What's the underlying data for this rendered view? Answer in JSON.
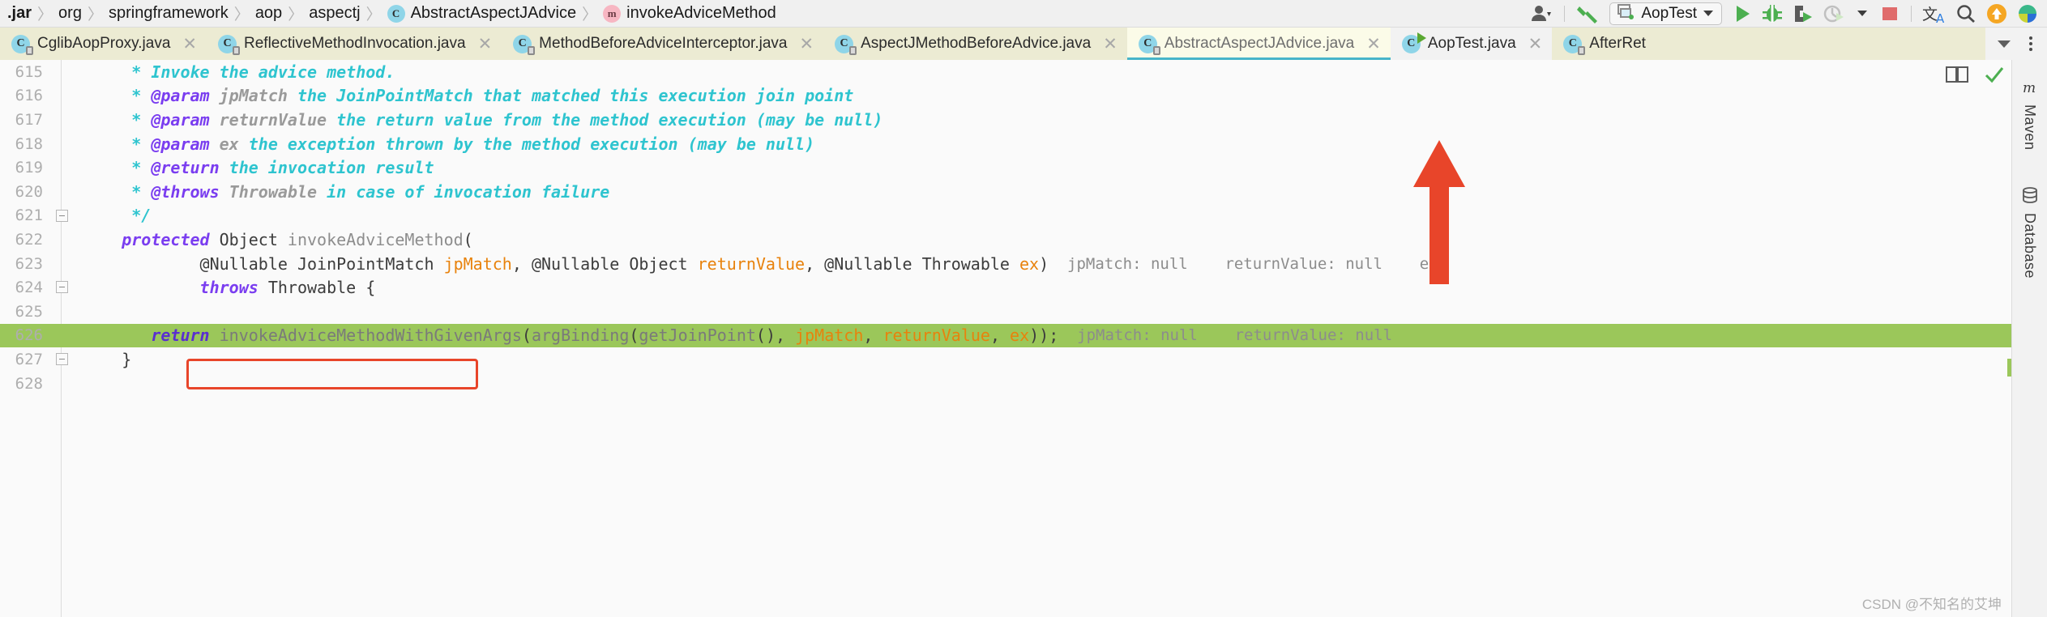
{
  "breadcrumb": {
    "items": [
      {
        "label": ".jar",
        "icon": null,
        "bold": true
      },
      {
        "label": "org",
        "icon": null,
        "bold": false
      },
      {
        "label": "springframework",
        "icon": null,
        "bold": false
      },
      {
        "label": "aop",
        "icon": null,
        "bold": false
      },
      {
        "label": "aspectj",
        "icon": null,
        "bold": false
      },
      {
        "label": "AbstractAspectJAdvice",
        "icon": "class-icon",
        "bold": false
      },
      {
        "label": "invokeAdviceMethod",
        "icon": "method-icon",
        "bold": false
      }
    ],
    "separator": "〉"
  },
  "toolbar": {
    "profile_icon": "user-icon",
    "build_icon": "hammer-icon",
    "run_config": {
      "label": "AopTest",
      "icon": "run-config-icon"
    },
    "run_icon": "run-icon",
    "debug_icon": "debug-icon",
    "coverage_icon": "run-with-coverage-icon",
    "profiler_icon": "profiler-icon",
    "stop_icon": "stop-icon",
    "translate_icon": "translate-icon",
    "search_icon": "search-icon",
    "update_icon": "update-icon",
    "ide_icon": "ide-logo-icon"
  },
  "tabs": [
    {
      "label": "CglibAopProxy.java",
      "icon": "java-class-icon",
      "state": "normal",
      "badge": "lock",
      "closable": true
    },
    {
      "label": "ReflectiveMethodInvocation.java",
      "icon": "java-class-icon",
      "state": "normal",
      "badge": "lock",
      "closable": true
    },
    {
      "label": "MethodBeforeAdviceInterceptor.java",
      "icon": "java-class-icon",
      "state": "normal",
      "badge": "lock",
      "closable": true
    },
    {
      "label": "AspectJMethodBeforeAdvice.java",
      "icon": "java-class-icon",
      "state": "normal",
      "badge": "lock",
      "closable": true
    },
    {
      "label": "AbstractAspectJAdvice.java",
      "icon": "java-class-icon",
      "state": "active",
      "badge": "lock",
      "closable": true
    },
    {
      "label": "AopTest.java",
      "icon": "java-class-icon",
      "state": "plain",
      "badge": "run",
      "closable": true
    },
    {
      "label": "AfterRet",
      "icon": "java-class-icon",
      "state": "normal",
      "badge": "lock",
      "closable": false
    }
  ],
  "tab_overflow": {
    "chevron": "chevron-down-icon",
    "kebab": "more-options-icon"
  },
  "editor": {
    "first_line_number": 615,
    "highlighted_line_number": 626,
    "lines": [
      {
        "n": 615,
        "fold": null,
        "tokens": [
          {
            "t": "      * ",
            "c": "c-doc"
          },
          {
            "t": "Invoke the advice method.",
            "c": "c-doc"
          }
        ]
      },
      {
        "n": 616,
        "fold": null,
        "tokens": [
          {
            "t": "      * ",
            "c": "c-doc"
          },
          {
            "t": "@param",
            "c": "c-tag"
          },
          {
            "t": " ",
            "c": "c-doc"
          },
          {
            "t": "jpMatch",
            "c": "c-docid"
          },
          {
            "t": " the JoinPointMatch that matched this execution join point",
            "c": "c-doc"
          }
        ]
      },
      {
        "n": 617,
        "fold": null,
        "tokens": [
          {
            "t": "      * ",
            "c": "c-doc"
          },
          {
            "t": "@param",
            "c": "c-tag"
          },
          {
            "t": " ",
            "c": "c-doc"
          },
          {
            "t": "returnValue",
            "c": "c-docid"
          },
          {
            "t": " the return value from the method execution (may be null)",
            "c": "c-doc"
          }
        ]
      },
      {
        "n": 618,
        "fold": null,
        "tokens": [
          {
            "t": "      * ",
            "c": "c-doc"
          },
          {
            "t": "@param",
            "c": "c-tag"
          },
          {
            "t": " ",
            "c": "c-doc"
          },
          {
            "t": "ex",
            "c": "c-docid"
          },
          {
            "t": " the exception thrown by the method execution (may be null)",
            "c": "c-doc"
          }
        ]
      },
      {
        "n": 619,
        "fold": null,
        "tokens": [
          {
            "t": "      * ",
            "c": "c-doc"
          },
          {
            "t": "@return",
            "c": "c-tag"
          },
          {
            "t": " the invocation result",
            "c": "c-doc"
          }
        ]
      },
      {
        "n": 620,
        "fold": null,
        "tokens": [
          {
            "t": "      * ",
            "c": "c-doc"
          },
          {
            "t": "@throws",
            "c": "c-tag"
          },
          {
            "t": " ",
            "c": "c-doc"
          },
          {
            "t": "Throwable",
            "c": "c-docid"
          },
          {
            "t": " in case of invocation failure",
            "c": "c-doc"
          }
        ]
      },
      {
        "n": 621,
        "fold": "minus",
        "tokens": [
          {
            "t": "      */",
            "c": "c-doc"
          }
        ]
      },
      {
        "n": 622,
        "fold": null,
        "tokens": [
          {
            "t": "     ",
            "c": "c-plain"
          },
          {
            "t": "protected",
            "c": "c-kw"
          },
          {
            "t": " Object ",
            "c": "c-plain"
          },
          {
            "t": "invokeAdviceMethod",
            "c": "c-ident"
          },
          {
            "t": "(",
            "c": "c-plain"
          }
        ]
      },
      {
        "n": 623,
        "fold": null,
        "tokens": [
          {
            "t": "             @Nullable JoinPointMatch ",
            "c": "c-plain"
          },
          {
            "t": "jpMatch",
            "c": "c-param"
          },
          {
            "t": ", @Nullable Object ",
            "c": "c-plain"
          },
          {
            "t": "returnValue",
            "c": "c-param"
          },
          {
            "t": ", @Nullable Throwable ",
            "c": "c-plain"
          },
          {
            "t": "ex",
            "c": "c-param"
          },
          {
            "t": ")",
            "c": "c-plain"
          }
        ],
        "hints": "  jpMatch: null    returnValue: null    ex:"
      },
      {
        "n": 624,
        "fold": "minus",
        "tokens": [
          {
            "t": "             ",
            "c": "c-plain"
          },
          {
            "t": "throws",
            "c": "c-kw"
          },
          {
            "t": " Throwable {",
            "c": "c-plain"
          }
        ]
      },
      {
        "n": 625,
        "fold": null,
        "tokens": [
          {
            "t": "",
            "c": "c-plain"
          }
        ]
      },
      {
        "n": 626,
        "fold": null,
        "highlight": true,
        "tokens": [
          {
            "t": "        ",
            "c": "c-plain"
          },
          {
            "t": "return",
            "c": "c-kw"
          },
          {
            "t": " ",
            "c": "c-plain"
          },
          {
            "t": "invokeAdviceMethodWithGivenArgs",
            "c": "c-ident"
          },
          {
            "t": "(",
            "c": "c-plain"
          },
          {
            "t": "argBinding",
            "c": "c-ident"
          },
          {
            "t": "(",
            "c": "c-plain"
          },
          {
            "t": "getJoinPoint",
            "c": "c-ident"
          },
          {
            "t": "(), ",
            "c": "c-plain"
          },
          {
            "t": "jpMatch",
            "c": "c-param"
          },
          {
            "t": ", ",
            "c": "c-plain"
          },
          {
            "t": "returnValue",
            "c": "c-param"
          },
          {
            "t": ", ",
            "c": "c-plain"
          },
          {
            "t": "ex",
            "c": "c-param"
          },
          {
            "t": "));",
            "c": "c-plain"
          }
        ],
        "hints": "  jpMatch: null    returnValue: null"
      },
      {
        "n": 627,
        "fold": "minus",
        "tokens": [
          {
            "t": "     }",
            "c": "c-plain"
          }
        ]
      },
      {
        "n": 628,
        "fold": null,
        "tokens": [
          {
            "t": "",
            "c": "c-plain"
          }
        ]
      }
    ],
    "annotation": {
      "type": "arrow",
      "color": "#e8452a",
      "points_to": "AbstractAspectJAdvice.java tab"
    },
    "red_box": {
      "color": "#e8452a",
      "around": "invokeAdviceMethodWithGivenArgs"
    }
  },
  "editor_tools": {
    "reader_mode_icon": "book-icon",
    "inspections_icon": "checkmark-icon"
  },
  "right_rail": {
    "items": [
      {
        "label": "Maven",
        "icon": "maven-icon"
      },
      {
        "label": "Database",
        "icon": "database-icon"
      }
    ]
  },
  "watermark": "CSDN @不知名的艾坤",
  "colors": {
    "tab_bar_bg": "#ecebd3",
    "active_tab_bg": "#fbfbe8",
    "active_tab_underline": "#47b5c9",
    "highlight_line": "#9bc75a",
    "annotation_red": "#e8452a",
    "accent_green": "#4caf50",
    "doc_comment": "#2ec4cf",
    "keyword": "#7a3df0",
    "param_hint": "#e8820c"
  }
}
